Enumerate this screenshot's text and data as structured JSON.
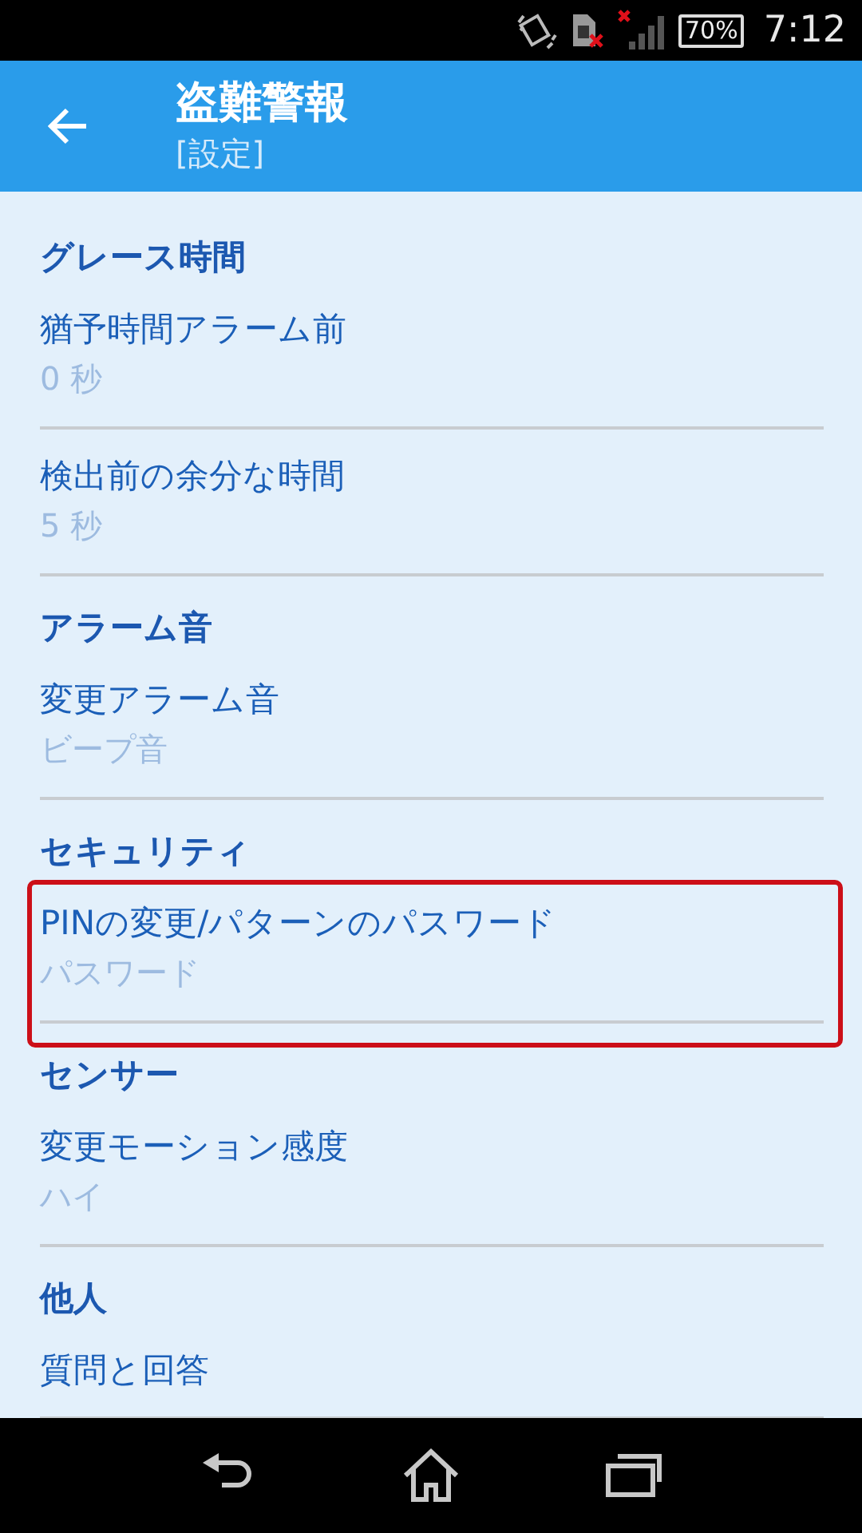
{
  "status_bar": {
    "battery": "70%",
    "time": "7:12"
  },
  "app_bar": {
    "title": "盗難警報",
    "subtitle": "[設定]"
  },
  "sections": [
    {
      "header": "グレース時間",
      "items": [
        {
          "title": "猶予時間アラーム前",
          "summary": "0 秒",
          "highlighted": false
        },
        {
          "title": "検出前の余分な時間",
          "summary": "5 秒",
          "highlighted": false
        }
      ]
    },
    {
      "header": "アラーム音",
      "items": [
        {
          "title": "変更アラーム音",
          "summary": "ビープ音",
          "highlighted": false
        }
      ]
    },
    {
      "header": "セキュリティ",
      "items": [
        {
          "title": "PINの変更/パターンのパスワード",
          "summary": "パスワード",
          "highlighted": true
        }
      ]
    },
    {
      "header": "センサー",
      "items": [
        {
          "title": "変更モーション感度",
          "summary": "ハイ",
          "highlighted": false
        }
      ]
    },
    {
      "header": "他人",
      "items": [
        {
          "title": "質問と回答",
          "highlighted": false
        }
      ]
    }
  ]
}
